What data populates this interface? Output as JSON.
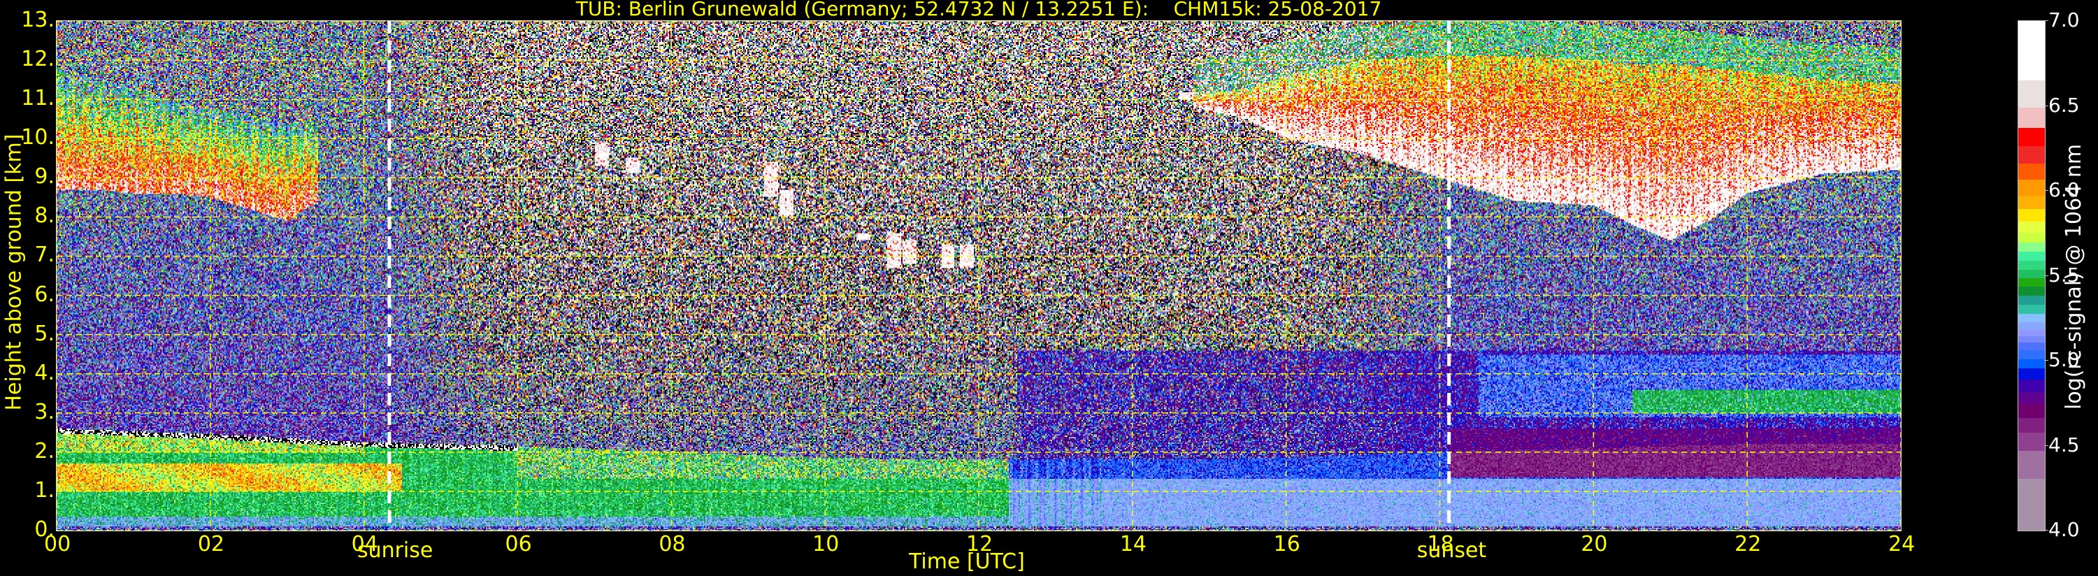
{
  "chart_data": {
    "type": "heatmap",
    "title": "TUB: Berlin Grunewald (Germany; 52.4732 N / 13.2251 E):    CHM15k: 25-08-2017",
    "xlabel": "Time [UTC]",
    "ylabel": "Height above ground [km]",
    "xlim": [
      0,
      24
    ],
    "ylim": [
      0,
      13
    ],
    "x_ticks": [
      0,
      2,
      4,
      6,
      8,
      10,
      12,
      14,
      16,
      18,
      20,
      22,
      24
    ],
    "x_tick_labels": [
      "00",
      "02",
      "04",
      "06",
      "08",
      "10",
      "12",
      "14",
      "16",
      "18",
      "20",
      "22",
      "24"
    ],
    "y_ticks": [
      0,
      1,
      2,
      3,
      4,
      5,
      6,
      7,
      8,
      9,
      10,
      11,
      12,
      13
    ],
    "y_tick_labels": [
      "0.",
      "1.",
      "2.",
      "3.",
      "4.",
      "5.",
      "6.",
      "7.",
      "8.",
      "9.",
      "10.",
      "11.",
      "12.",
      "13."
    ],
    "grid": true,
    "grid_color": "#ffff00",
    "markers": [
      {
        "label": "sunrise",
        "x": 4.33
      },
      {
        "label": "sunset",
        "x": 18.12
      }
    ],
    "colorbar": {
      "label": "log(rc-signal) @ 1064 nm",
      "range": [
        4.0,
        7.0
      ],
      "ticks": [
        4.0,
        4.5,
        5.0,
        5.5,
        6.0,
        6.5,
        7.0
      ],
      "tick_labels": [
        "4.0",
        "4.5",
        "5.0",
        "5.5",
        "6.0",
        "6.5",
        "7.0"
      ],
      "below_color": "#000000",
      "bands": [
        {
          "from": 4.0,
          "to": 4.308,
          "color": "#a890a8"
        },
        {
          "from": 4.308,
          "to": 4.47,
          "color": "#a070a0"
        },
        {
          "from": 4.47,
          "to": 4.578,
          "color": "#904090"
        },
        {
          "from": 4.578,
          "to": 4.665,
          "color": "#802080"
        },
        {
          "from": 4.665,
          "to": 4.751,
          "color": "#700070"
        },
        {
          "from": 4.751,
          "to": 4.816,
          "color": "#600090"
        },
        {
          "from": 4.816,
          "to": 4.892,
          "color": "#4000b0"
        },
        {
          "from": 4.892,
          "to": 4.957,
          "color": "#0010e0"
        },
        {
          "from": 4.957,
          "to": 5.011,
          "color": "#0060ff"
        },
        {
          "from": 5.011,
          "to": 5.065,
          "color": "#3070ff"
        },
        {
          "from": 5.065,
          "to": 5.109,
          "color": "#5070ff"
        },
        {
          "from": 5.109,
          "to": 5.146,
          "color": "#7888ff"
        },
        {
          "from": 5.146,
          "to": 5.184,
          "color": "#9098ff"
        },
        {
          "from": 5.184,
          "to": 5.227,
          "color": "#88a8ff"
        },
        {
          "from": 5.227,
          "to": 5.279,
          "color": "#88c0ff"
        },
        {
          "from": 5.279,
          "to": 5.333,
          "color": "#30c0a8"
        },
        {
          "from": 5.333,
          "to": 5.383,
          "color": "#20a090"
        },
        {
          "from": 5.383,
          "to": 5.437,
          "color": "#109030"
        },
        {
          "from": 5.437,
          "to": 5.487,
          "color": "#20aa10"
        },
        {
          "from": 5.487,
          "to": 5.535,
          "color": "#20c060"
        },
        {
          "from": 5.535,
          "to": 5.589,
          "color": "#30d880"
        },
        {
          "from": 5.589,
          "to": 5.643,
          "color": "#40f0a0"
        },
        {
          "from": 5.643,
          "to": 5.697,
          "color": "#88ff88"
        },
        {
          "from": 5.697,
          "to": 5.757,
          "color": "#ccff40"
        },
        {
          "from": 5.757,
          "to": 5.822,
          "color": "#e6ff40"
        },
        {
          "from": 5.822,
          "to": 5.897,
          "color": "#ffe600"
        },
        {
          "from": 5.897,
          "to": 5.973,
          "color": "#ffb000"
        },
        {
          "from": 5.973,
          "to": 6.066,
          "color": "#ff9900"
        },
        {
          "from": 6.066,
          "to": 6.161,
          "color": "#ff5a00"
        },
        {
          "from": 6.161,
          "to": 6.265,
          "color": "#f02828"
        },
        {
          "from": 6.265,
          "to": 6.373,
          "color": "#ff0000"
        },
        {
          "from": 6.373,
          "to": 6.49,
          "color": "#f0c0c0"
        },
        {
          "from": 6.49,
          "to": 6.654,
          "color": "#ebe0e0"
        },
        {
          "from": 6.654,
          "to": 7.0,
          "color": "#ffffff"
        }
      ]
    },
    "features": {
      "boundary_layer_top_km": {
        "t": [
          0,
          2,
          4,
          6,
          8,
          10,
          12,
          14,
          16,
          18,
          20,
          22,
          24
        ],
        "h": [
          2.6,
          2.45,
          2.25,
          2.15,
          2.0,
          1.85,
          1.8,
          1.8,
          1.85,
          2.0,
          2.1,
          2.2,
          2.2
        ]
      },
      "cirrus_morning": {
        "t": [
          0.0,
          0.5,
          1.0,
          1.5,
          2.0,
          2.5,
          3.0,
          3.4
        ],
        "base_km": [
          8.7,
          8.7,
          8.6,
          8.6,
          8.5,
          8.2,
          7.9,
          8.4
        ],
        "top_km": [
          11.8,
          11.5,
          11.3,
          11.0,
          10.8,
          10.6,
          10.4,
          10.5
        ]
      },
      "cirrus_afternoon": {
        "t": [
          14.8,
          15.5,
          16,
          17,
          18,
          19,
          20,
          20.5,
          21,
          21.5,
          22,
          23,
          24
        ],
        "base_km": [
          10.8,
          10.5,
          10.0,
          9.6,
          9.0,
          8.4,
          8.3,
          7.8,
          7.4,
          7.9,
          8.6,
          9.1,
          9.2
        ],
        "top_km": [
          11.1,
          11.3,
          11.6,
          12.0,
          12.1,
          12.1,
          12.0,
          11.9,
          11.9,
          11.8,
          11.7,
          11.5,
          11.4
        ]
      },
      "virga_streaks": [
        {
          "t": 7.1,
          "base_km": 9.3,
          "top_km": 9.9
        },
        {
          "t": 7.5,
          "base_km": 9.1,
          "top_km": 9.5
        },
        {
          "t": 9.3,
          "base_km": 8.5,
          "top_km": 9.4
        },
        {
          "t": 9.5,
          "base_km": 8.0,
          "top_km": 8.7
        },
        {
          "t": 10.5,
          "base_km": 7.4,
          "top_km": 7.6
        },
        {
          "t": 10.9,
          "base_km": 6.7,
          "top_km": 7.6
        },
        {
          "t": 11.1,
          "base_km": 6.8,
          "top_km": 7.4
        },
        {
          "t": 11.6,
          "base_km": 6.7,
          "top_km": 7.3
        },
        {
          "t": 11.85,
          "base_km": 6.7,
          "top_km": 7.3
        },
        {
          "t": 14.7,
          "base_km": 11.0,
          "top_km": 11.2
        }
      ]
    }
  }
}
